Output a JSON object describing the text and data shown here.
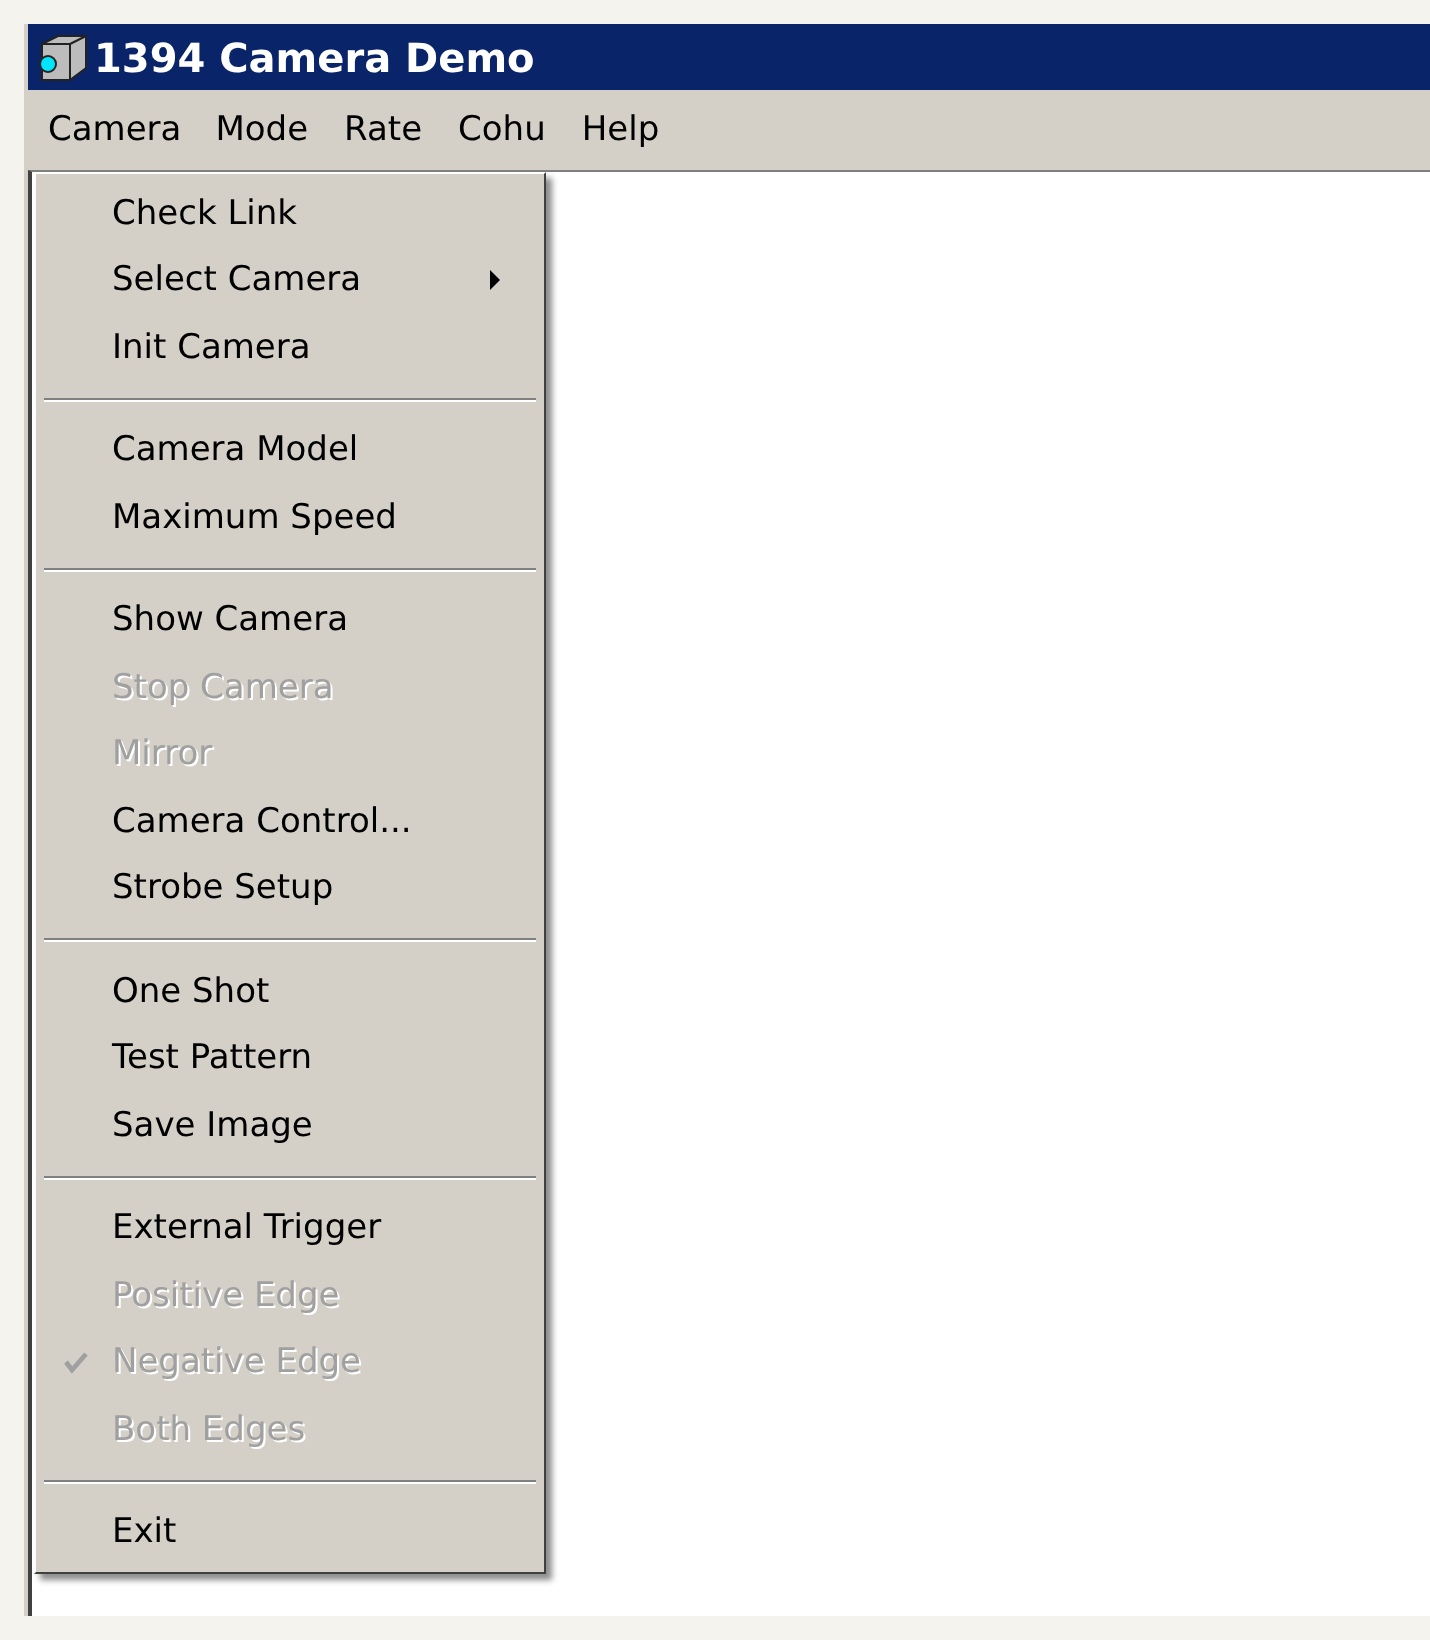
{
  "window": {
    "title": "1394 Camera Demo"
  },
  "menu_bar": [
    {
      "label": "Camera",
      "selected": true
    },
    {
      "label": "Mode",
      "selected": false
    },
    {
      "label": "Rate",
      "selected": false
    },
    {
      "label": "Cohu",
      "selected": false
    },
    {
      "label": "Help",
      "selected": false
    }
  ],
  "menu": [
    {
      "kind": "item",
      "label": "Check Link",
      "disabled": false,
      "checked": false,
      "submenu": false
    },
    {
      "kind": "item",
      "label": "Select Camera",
      "disabled": false,
      "checked": false,
      "submenu": true
    },
    {
      "kind": "item",
      "label": "Init Camera",
      "disabled": false,
      "checked": false,
      "submenu": false
    },
    {
      "kind": "separator"
    },
    {
      "kind": "item",
      "label": "Camera Model",
      "disabled": false,
      "checked": false,
      "submenu": false
    },
    {
      "kind": "item",
      "label": "Maximum Speed",
      "disabled": false,
      "checked": false,
      "submenu": false
    },
    {
      "kind": "separator"
    },
    {
      "kind": "item",
      "label": "Show Camera",
      "disabled": false,
      "checked": false,
      "submenu": false
    },
    {
      "kind": "item",
      "label": "Stop Camera",
      "disabled": true,
      "checked": false,
      "submenu": false
    },
    {
      "kind": "item",
      "label": "Mirror",
      "disabled": true,
      "checked": false,
      "submenu": false
    },
    {
      "kind": "item",
      "label": "Camera Control...",
      "disabled": false,
      "checked": false,
      "submenu": false
    },
    {
      "kind": "item",
      "label": "Strobe Setup",
      "disabled": false,
      "checked": false,
      "submenu": false
    },
    {
      "kind": "separator"
    },
    {
      "kind": "item",
      "label": "One Shot",
      "disabled": false,
      "checked": false,
      "submenu": false
    },
    {
      "kind": "item",
      "label": "Test Pattern",
      "disabled": false,
      "checked": false,
      "submenu": false
    },
    {
      "kind": "item",
      "label": "Save Image",
      "disabled": false,
      "checked": false,
      "submenu": false
    },
    {
      "kind": "separator"
    },
    {
      "kind": "item",
      "label": "External Trigger",
      "disabled": false,
      "checked": false,
      "submenu": false
    },
    {
      "kind": "item",
      "label": "Positive Edge",
      "disabled": true,
      "checked": false,
      "submenu": false
    },
    {
      "kind": "item",
      "label": "Negative Edge",
      "disabled": true,
      "checked": true,
      "submenu": false
    },
    {
      "kind": "item",
      "label": "Both Edges",
      "disabled": true,
      "checked": false,
      "submenu": false
    },
    {
      "kind": "separator"
    },
    {
      "kind": "item",
      "label": "Exit",
      "disabled": false,
      "checked": false,
      "submenu": false
    }
  ]
}
